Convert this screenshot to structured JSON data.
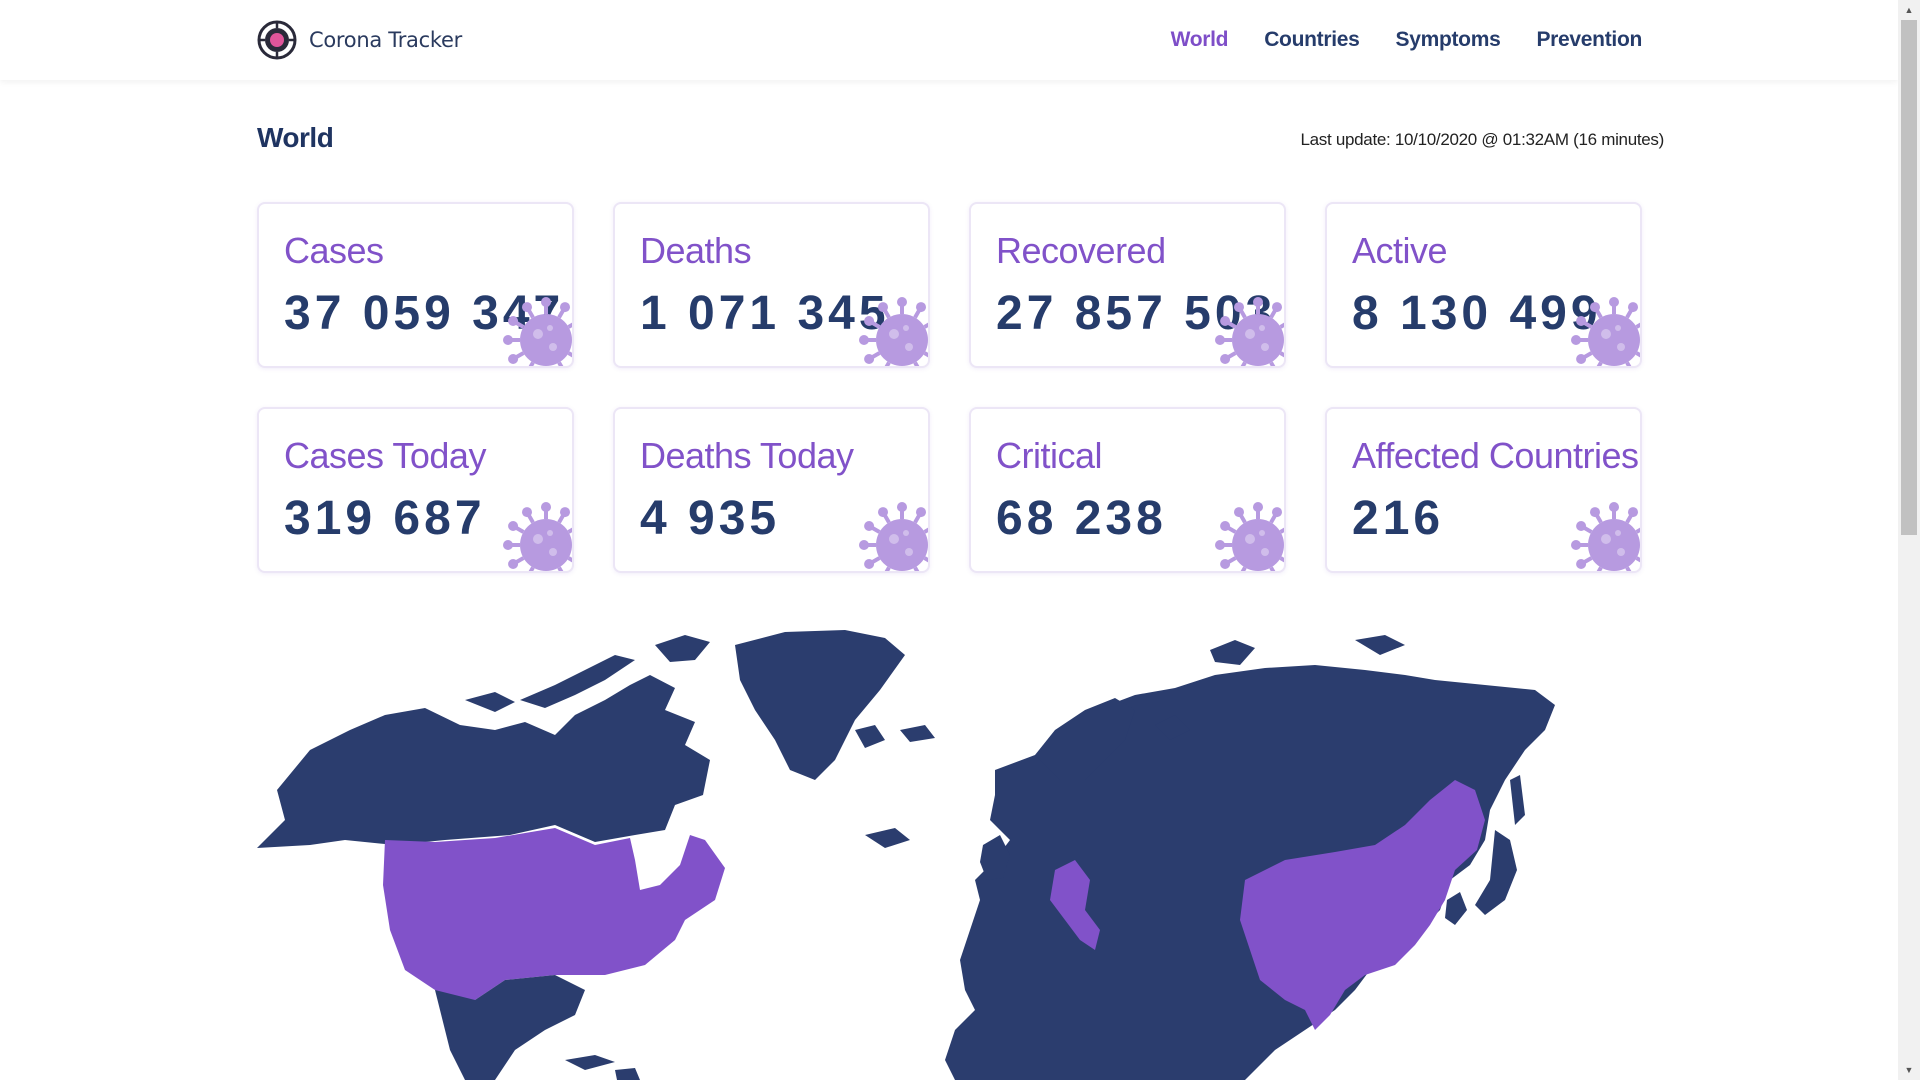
{
  "brand": {
    "name": "Corona Tracker"
  },
  "nav": {
    "items": [
      "World",
      "Countries",
      "Symptoms",
      "Prevention"
    ],
    "active": "World"
  },
  "page": {
    "title": "World",
    "last_update": "Last update: 10/10/2020 @ 01:32AM (16 minutes)"
  },
  "stats": [
    {
      "label": "Cases",
      "value": "37 059 347"
    },
    {
      "label": "Deaths",
      "value": "1 071 345"
    },
    {
      "label": "Recovered",
      "value": "27 857 503"
    },
    {
      "label": "Active",
      "value": "8 130 499"
    },
    {
      "label": "Cases Today",
      "value": "319 687"
    },
    {
      "label": "Deaths Today",
      "value": "4 935"
    },
    {
      "label": "Critical",
      "value": "68 238"
    },
    {
      "label": "Affected Countries",
      "value": "216"
    }
  ],
  "colors": {
    "accent": "#7e4ec8",
    "navy": "#263c6b",
    "map_land": "#2b3d6e",
    "map_highlight": "#8152c9",
    "virus": "#b79ae0"
  }
}
